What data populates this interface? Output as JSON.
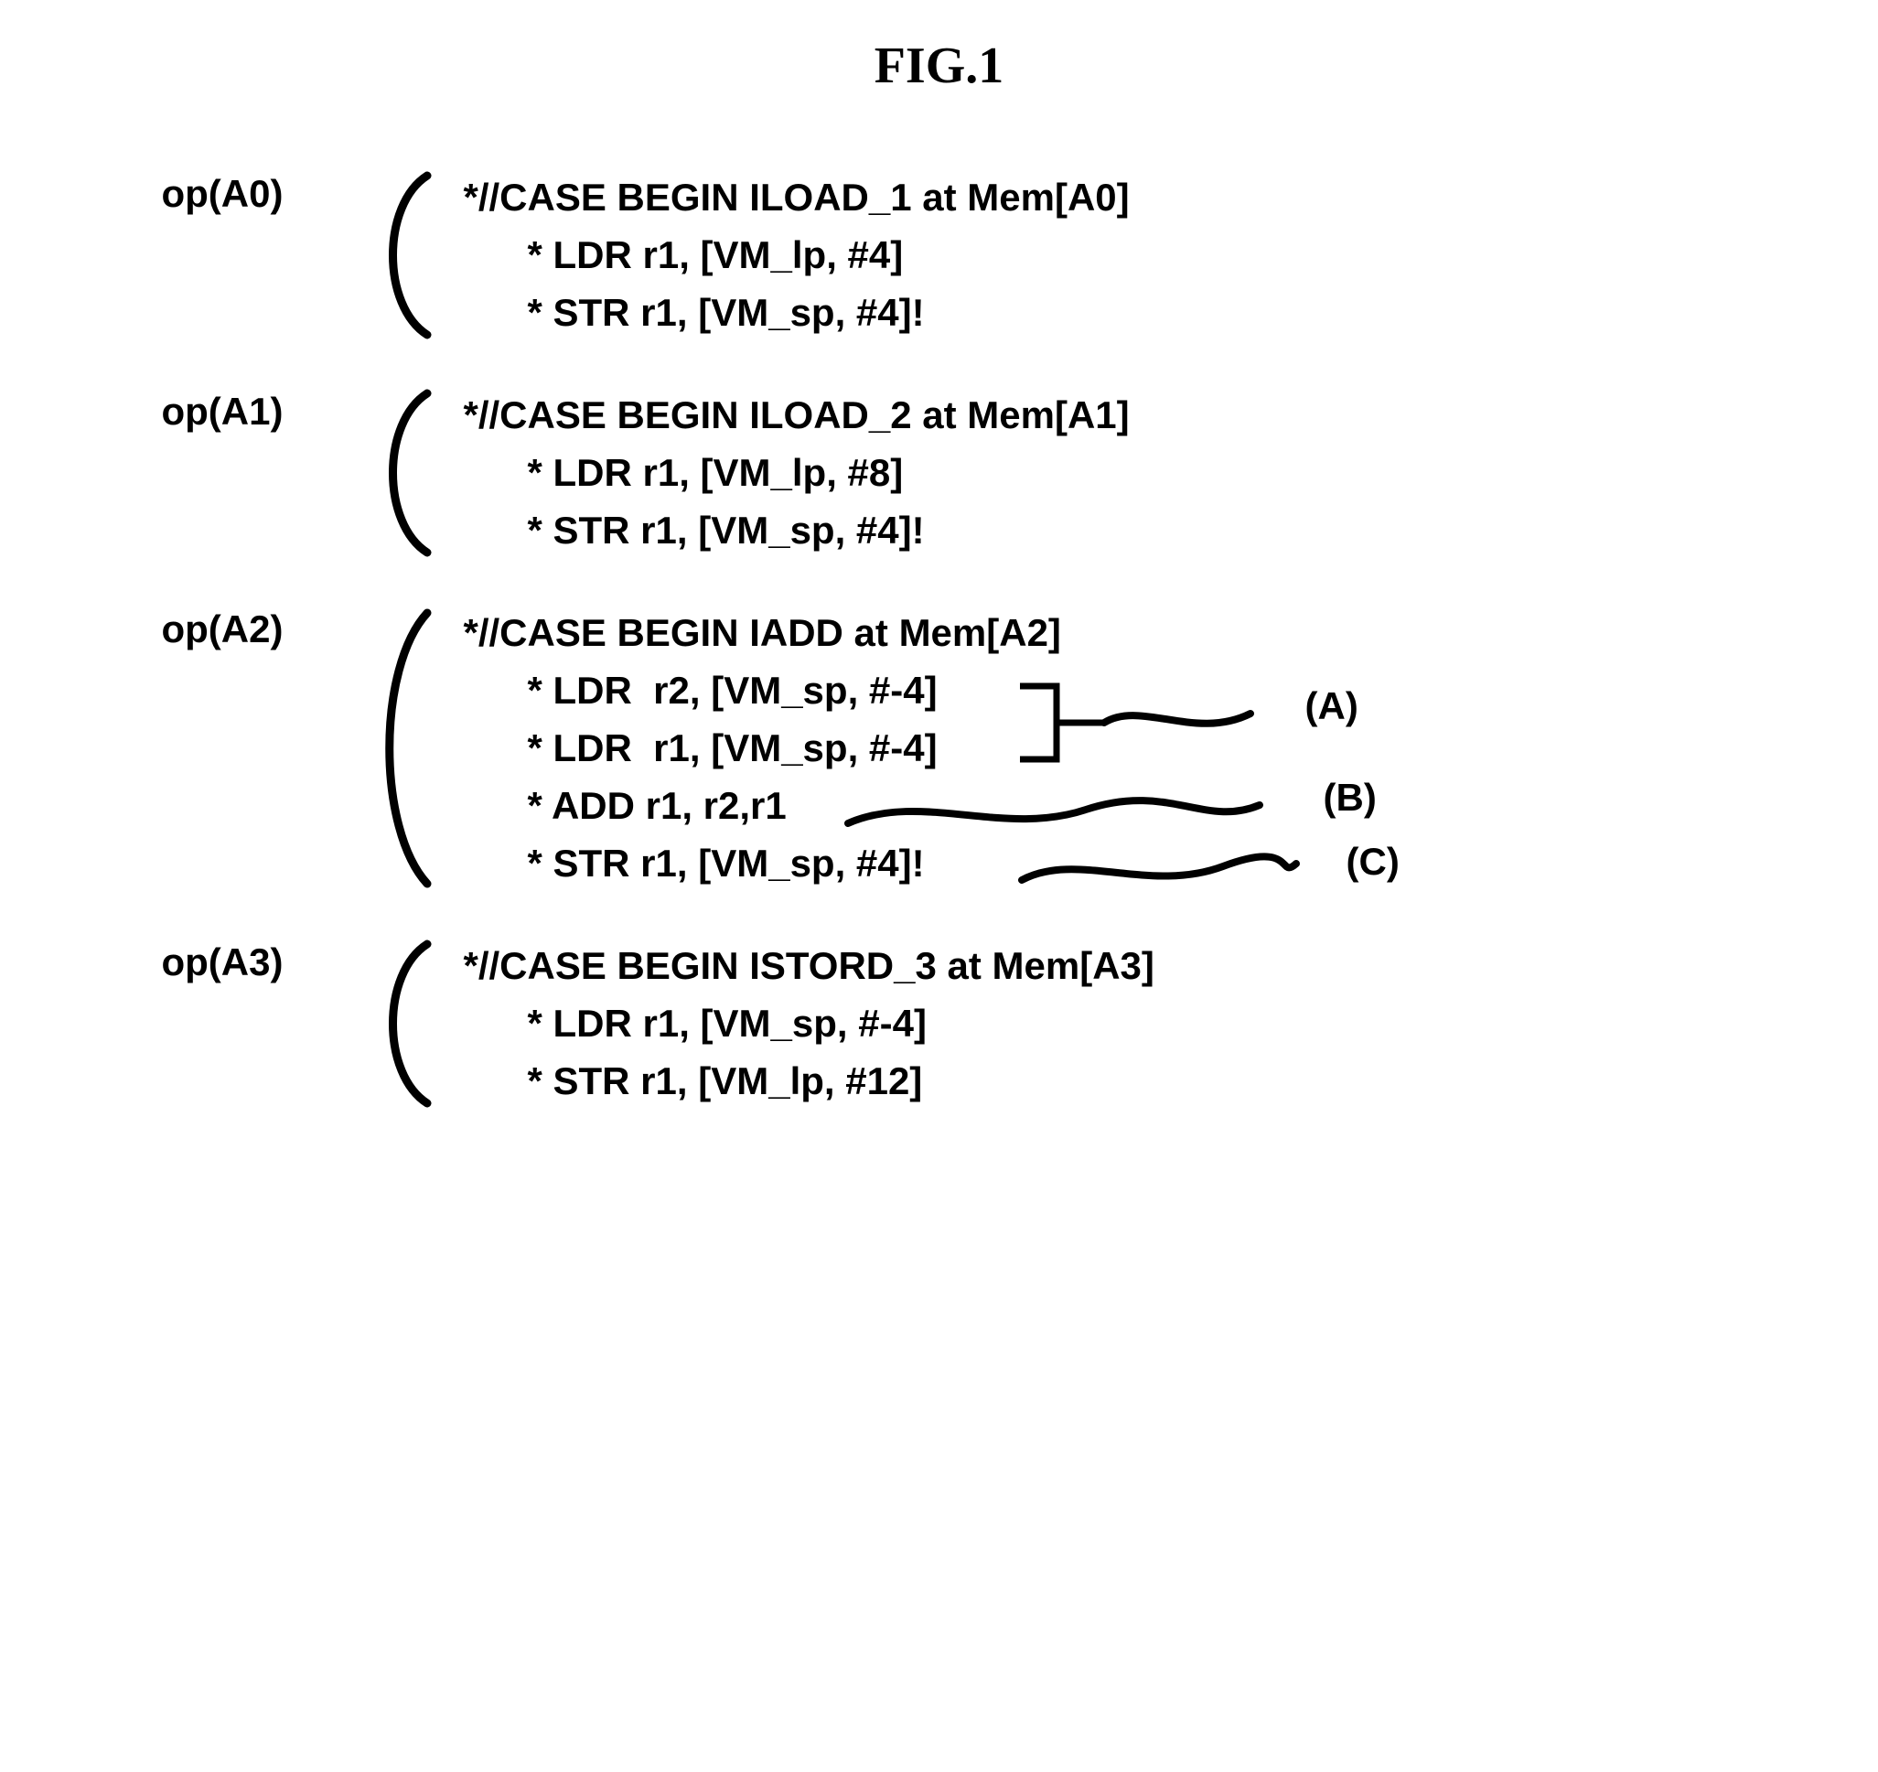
{
  "title": "FIG.1",
  "blocks": [
    {
      "op": "op(A0)",
      "comment": "*//CASE BEGIN ILOAD_1 at Mem[A0]",
      "instrs": [
        "* LDR r1, [VM_lp, #4]",
        "* STR r1, [VM_sp, #4]!"
      ]
    },
    {
      "op": "op(A1)",
      "comment": "*//CASE BEGIN ILOAD_2 at Mem[A1]",
      "instrs": [
        "* LDR r1, [VM_lp, #8]",
        "* STR r1, [VM_sp, #4]!"
      ]
    },
    {
      "op": "op(A2)",
      "comment": "*//CASE BEGIN IADD at Mem[A2]",
      "instrs": [
        "* LDR  r2, [VM_sp, #-4]",
        "* LDR  r1, [VM_sp, #-4]",
        "* ADD r1, r2,r1",
        "* STR r1, [VM_sp, #4]!"
      ],
      "annotations": [
        "(A)",
        "(B)",
        "(C)"
      ]
    },
    {
      "op": "op(A3)",
      "comment": "*//CASE BEGIN ISTORD_3 at Mem[A3]",
      "instrs": [
        "* LDR r1, [VM_sp, #-4]",
        "* STR r1, [VM_lp, #12]"
      ]
    }
  ]
}
